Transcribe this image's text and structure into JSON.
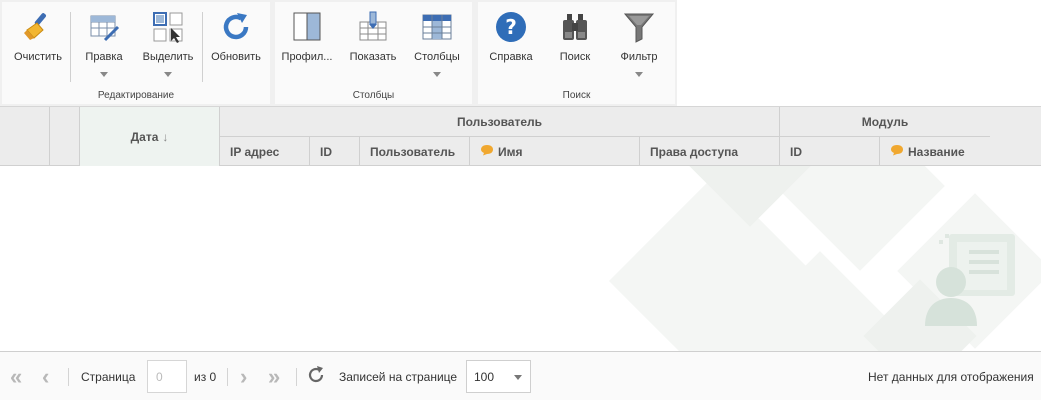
{
  "ribbon": {
    "groups": [
      {
        "label": "Редактирование",
        "buttons": [
          {
            "label": "Очистить",
            "icon": "broom-icon"
          },
          {
            "label": "Правка",
            "icon": "grid-edit-icon"
          },
          {
            "label": "Выделить",
            "icon": "select-cells-icon"
          },
          {
            "label": "Обновить",
            "icon": "refresh-icon"
          }
        ]
      },
      {
        "label": "Столбцы",
        "buttons": [
          {
            "label": "Профил...",
            "icon": "column-profile-icon"
          },
          {
            "label": "Показать",
            "icon": "show-columns-icon"
          },
          {
            "label": "Столбцы",
            "icon": "columns-icon"
          }
        ]
      },
      {
        "label": "Поиск",
        "buttons": [
          {
            "label": "Справка",
            "icon": "help-icon"
          },
          {
            "label": "Поиск",
            "icon": "binoculars-icon"
          },
          {
            "label": "Фильтр",
            "icon": "filter-icon"
          }
        ]
      }
    ]
  },
  "grid": {
    "date_column": "Дата",
    "band_user": "Пользователь",
    "band_module": "Модуль",
    "columns_user": [
      "IP адрес",
      "ID",
      "Пользователь",
      "Имя",
      "Права доступа"
    ],
    "columns_module": [
      "ID",
      "Название"
    ],
    "sort_indicator": "↓"
  },
  "pager": {
    "page_label": "Страница",
    "page_value": "0",
    "of_label": "из 0",
    "records_label": "Записей на странице",
    "page_size": "100",
    "no_data": "Нет данных для отображения"
  },
  "colors": {
    "accent_blue": "#3a78c3",
    "date_header_bg": "#eef3f0",
    "comment_orange": "#f0a830"
  }
}
